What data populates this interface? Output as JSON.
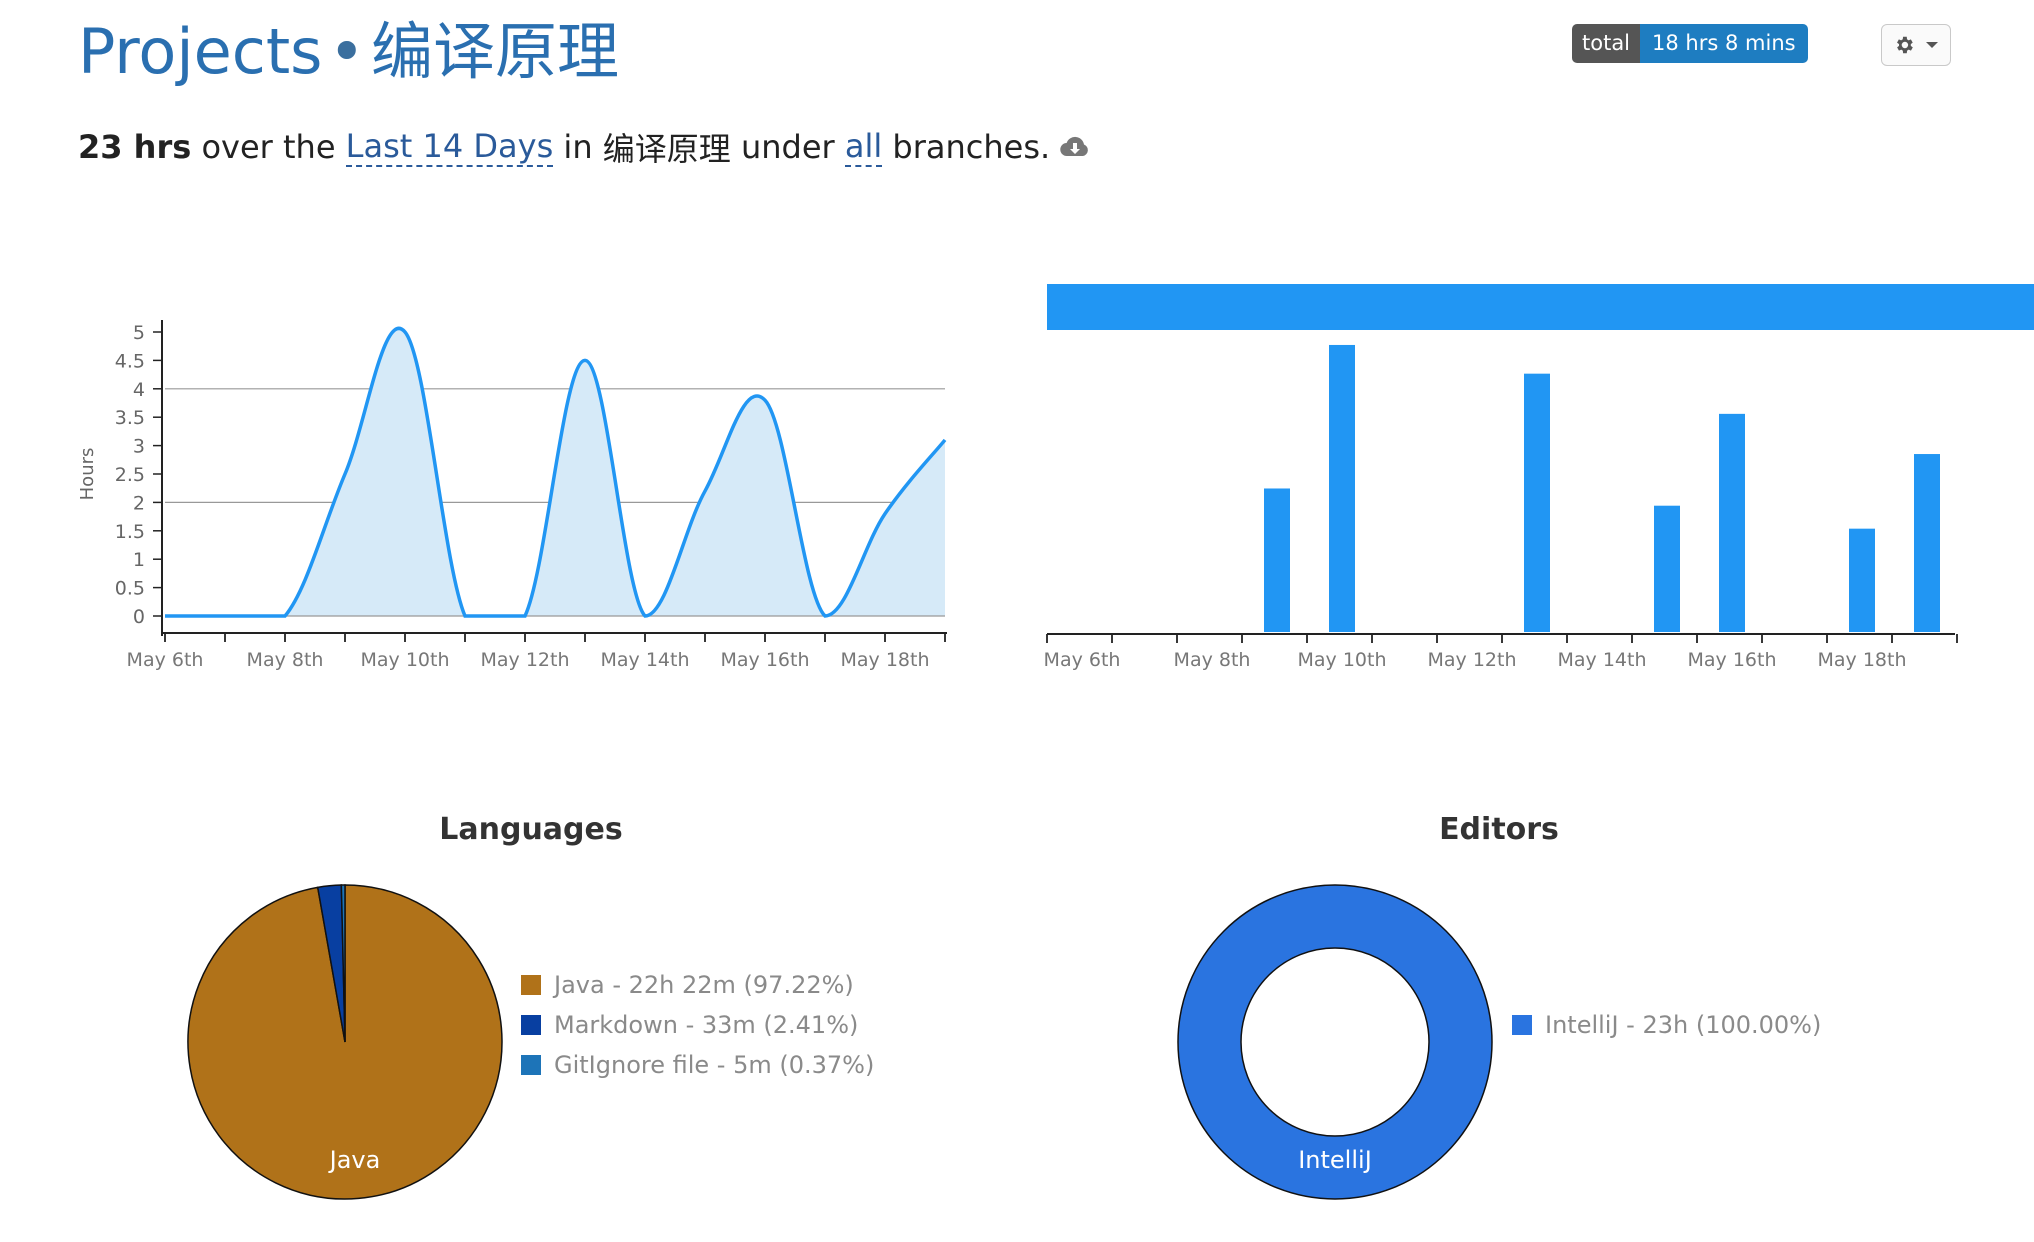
{
  "header": {
    "title_prefix": "Projects",
    "separator": "•",
    "project_name": "编译原理",
    "total_label": "total",
    "total_value": "18 hrs 8 mins"
  },
  "summary": {
    "hours": "23 hrs",
    "text_over": "over the",
    "range_link": "Last 14 Days",
    "text_in": "in",
    "project": "编译原理",
    "text_under": "under",
    "branch_link": "all",
    "text_end": "branches."
  },
  "icons": {
    "settings": "gear-icon",
    "dropdown": "caret-down-icon",
    "download": "cloud-download-icon"
  },
  "colors": {
    "accent_blue": "#2196f3",
    "area_fill": "#d6eaf8",
    "java": "#b07219",
    "markdown": "#083fa1",
    "gitignore": "#1d74b8",
    "intellij": "#2a74e0"
  },
  "chart_data": [
    {
      "type": "area",
      "ylabel": "Hours",
      "ylim": [
        0,
        5
      ],
      "yticks": [
        "0",
        "0.5",
        "1",
        "1.5",
        "2",
        "2.5",
        "3",
        "3.5",
        "4",
        "4.5",
        "5"
      ],
      "gridlines": [
        2,
        4
      ],
      "xticks": [
        "May 6th",
        "May 8th",
        "May 10th",
        "May 12th",
        "May 14th",
        "May 16th",
        "May 18th"
      ],
      "x": [
        "May 6th",
        "May 7th",
        "May 8th",
        "May 9th",
        "May 10th",
        "May 11th",
        "May 12th",
        "May 13th",
        "May 14th",
        "May 15th",
        "May 16th",
        "May 17th",
        "May 18th",
        "May 19th"
      ],
      "values": [
        0,
        0,
        0,
        2.5,
        5.0,
        0,
        0,
        4.5,
        0,
        2.2,
        3.8,
        0,
        1.8,
        3.1
      ]
    },
    {
      "type": "bar",
      "xticks": [
        "May 6th",
        "May 8th",
        "May 10th",
        "May 12th",
        "May 14th",
        "May 16th",
        "May 18th"
      ],
      "x": [
        "May 6th",
        "May 7th",
        "May 8th",
        "May 9th",
        "May 10th",
        "May 11th",
        "May 12th",
        "May 13th",
        "May 14th",
        "May 15th",
        "May 16th",
        "May 17th",
        "May 18th",
        "May 19th"
      ],
      "values": [
        0,
        0,
        0,
        2.5,
        5.0,
        0,
        0,
        4.5,
        0,
        2.2,
        3.8,
        0,
        1.8,
        3.1
      ],
      "ylim": [
        0,
        5.4
      ]
    },
    {
      "type": "pie",
      "title": "Languages",
      "slices": [
        {
          "label": "Java",
          "legend": "Java - 22h 22m (97.22%)",
          "value": 97.22,
          "color": "#b07219"
        },
        {
          "label": "Markdown",
          "legend": "Markdown - 33m (2.41%)",
          "value": 2.41,
          "color": "#083fa1"
        },
        {
          "label": "GitIgnore file",
          "legend": "GitIgnore file - 5m (0.37%)",
          "value": 0.37,
          "color": "#1d74b8"
        }
      ]
    },
    {
      "type": "pie",
      "title": "Editors",
      "slices": [
        {
          "label": "IntelliJ",
          "legend": "IntelliJ - 23h (100.00%)",
          "value": 100.0,
          "color": "#2a74e0"
        }
      ]
    }
  ]
}
